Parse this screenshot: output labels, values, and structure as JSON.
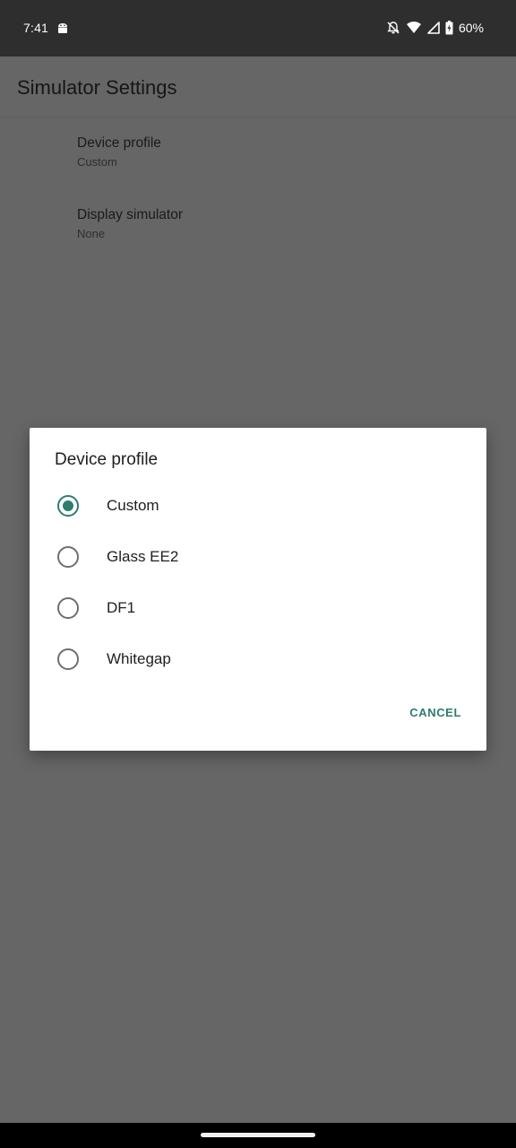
{
  "status_bar": {
    "time": "7:41",
    "left_icons": [
      "android-notification-icon"
    ],
    "right_icons": [
      "notifications-off-icon",
      "wifi-icon",
      "cellular-signal-icon",
      "battery-charging-icon"
    ],
    "battery_percent": "60%"
  },
  "app_bar": {
    "title": "Simulator Settings"
  },
  "preferences": [
    {
      "title": "Device profile",
      "summary": "Custom"
    },
    {
      "title": "Display simulator",
      "summary": "None"
    }
  ],
  "dialog": {
    "title": "Device profile",
    "options": [
      {
        "label": "Custom",
        "checked": true
      },
      {
        "label": "Glass EE2",
        "checked": false
      },
      {
        "label": "DF1",
        "checked": false
      },
      {
        "label": "Whitegap",
        "checked": false
      }
    ],
    "cancel_label": "CANCEL",
    "accent_color": "#2e7d6e"
  }
}
